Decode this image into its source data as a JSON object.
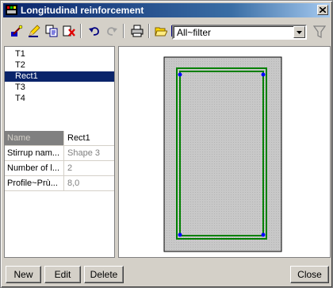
{
  "window": {
    "title": "Longitudinal reinforcement"
  },
  "toolbar": {
    "buttons": [
      "bar-insert-icon",
      "edit-pencil-icon",
      "copy-icon",
      "delete-icon",
      "undo-icon",
      "redo-icon",
      "print-icon",
      "open-folder-icon",
      "save-icon"
    ],
    "filter_value": "All~filter"
  },
  "tree": {
    "items": [
      {
        "label": "T1",
        "selected": false
      },
      {
        "label": "T2",
        "selected": false
      },
      {
        "label": "Rect1",
        "selected": true
      },
      {
        "label": "T3",
        "selected": false
      },
      {
        "label": "T4",
        "selected": false
      }
    ]
  },
  "properties": {
    "rows": [
      {
        "name": "Name",
        "value": "Rect1"
      },
      {
        "name": "Stirrup nam...",
        "value": "Shape 3"
      },
      {
        "name": "Number of l...",
        "value": "2"
      },
      {
        "name": "Profile~Prù...",
        "value": "8,0"
      }
    ]
  },
  "buttons": {
    "new": "New",
    "edit": "Edit",
    "delete": "Delete",
    "close": "Close"
  },
  "colors": {
    "selection": "#0a246a",
    "section_fill": "#c0c0c0",
    "stirrup": "#008000",
    "bar": "#0000ff"
  }
}
